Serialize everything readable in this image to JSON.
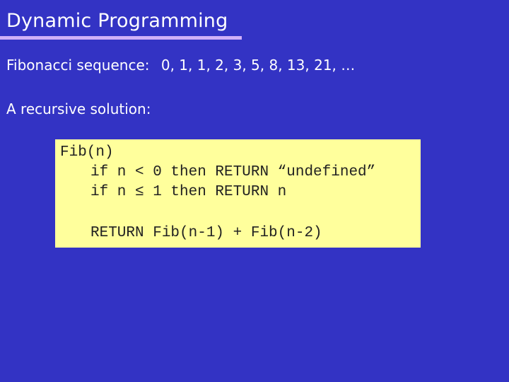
{
  "slide": {
    "title": "Dynamic Programming",
    "colors": {
      "background": "#3333c4",
      "title_rule": "#d0b0f8",
      "code_box": "#ffff9c",
      "text": "#ffffff"
    },
    "fibonacci_label": "Fibonacci sequence:",
    "fibonacci_values": "0, 1, 1, 2, 3, 5, 8, 13, 21, …",
    "recursive_label": "A recursive solution:",
    "code": {
      "lines": [
        "Fib(n)",
        "if n < 0 then RETURN “undefined”",
        "if n ≤ 1 then RETURN n",
        "RETURN Fib(n-1) + Fib(n-2)"
      ]
    }
  }
}
